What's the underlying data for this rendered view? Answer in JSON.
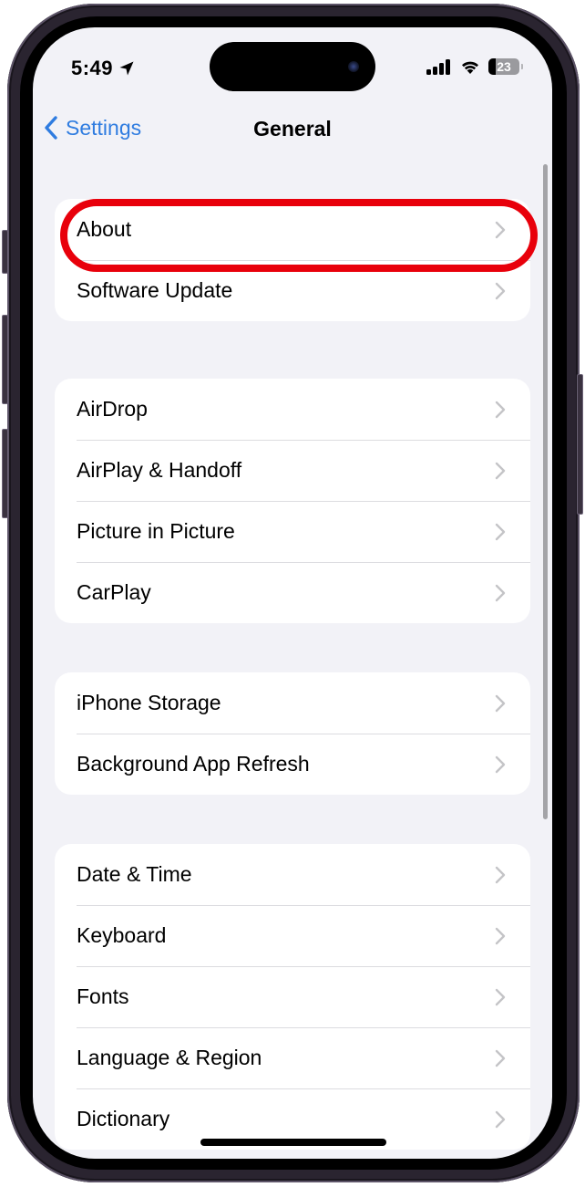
{
  "status_bar": {
    "time": "5:49",
    "location_icon": "location-arrow-icon",
    "signal_icon": "cellular-signal-icon",
    "wifi_icon": "wifi-icon",
    "battery_percent": "23",
    "battery_level": 0.23
  },
  "nav": {
    "back_label": "Settings",
    "back_icon": "chevron-left-icon",
    "title": "General"
  },
  "groups": [
    {
      "items": [
        {
          "label": "About",
          "highlighted": true
        },
        {
          "label": "Software Update"
        }
      ]
    },
    {
      "items": [
        {
          "label": "AirDrop"
        },
        {
          "label": "AirPlay & Handoff"
        },
        {
          "label": "Picture in Picture"
        },
        {
          "label": "CarPlay"
        }
      ]
    },
    {
      "items": [
        {
          "label": "iPhone Storage"
        },
        {
          "label": "Background App Refresh"
        }
      ]
    },
    {
      "items": [
        {
          "label": "Date & Time"
        },
        {
          "label": "Keyboard"
        },
        {
          "label": "Fonts"
        },
        {
          "label": "Language & Region"
        },
        {
          "label": "Dictionary"
        }
      ]
    }
  ],
  "colors": {
    "accent": "#2f7ce0",
    "highlight_ring": "#e8000b",
    "background": "#f2f2f7",
    "cell": "#ffffff",
    "chevron": "#c4c4c7"
  }
}
